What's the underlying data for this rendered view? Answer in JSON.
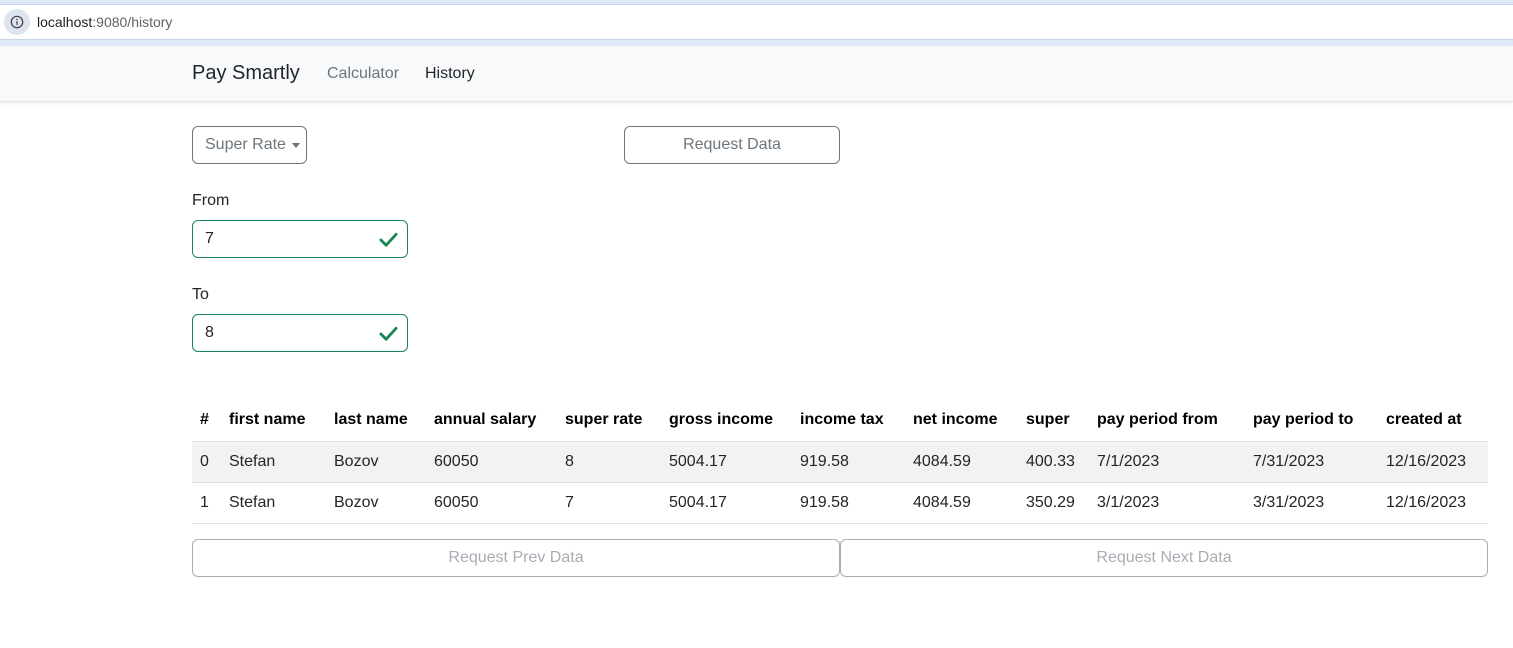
{
  "browser": {
    "url_host": "localhost",
    "url_path": ":9080/history"
  },
  "navbar": {
    "brand": "Pay Smartly",
    "links": [
      {
        "label": "Calculator",
        "active": false
      },
      {
        "label": "History",
        "active": true
      }
    ]
  },
  "filters": {
    "dropdown_label": "Super Rate",
    "request_button": "Request Data",
    "from_label": "From",
    "from_value": "7",
    "to_label": "To",
    "to_value": "8"
  },
  "table": {
    "headers": [
      "#",
      "first name",
      "last name",
      "annual salary",
      "super rate",
      "gross income",
      "income tax",
      "net income",
      "super",
      "pay period from",
      "pay period to",
      "created at"
    ],
    "rows": [
      [
        "0",
        "Stefan",
        "Bozov",
        "60050",
        "8",
        "5004.17",
        "919.58",
        "4084.59",
        "400.33",
        "7/1/2023",
        "7/31/2023",
        "12/16/2023"
      ],
      [
        "1",
        "Stefan",
        "Bozov",
        "60050",
        "7",
        "5004.17",
        "919.58",
        "4084.59",
        "350.29",
        "3/1/2023",
        "3/31/2023",
        "12/16/2023"
      ]
    ]
  },
  "pagination": {
    "prev_label": "Request Prev Data",
    "next_label": "Request Next Data"
  },
  "colors": {
    "valid_green": "#198754",
    "secondary_gray": "#6c757d",
    "stripe": "#f2f2f2"
  }
}
